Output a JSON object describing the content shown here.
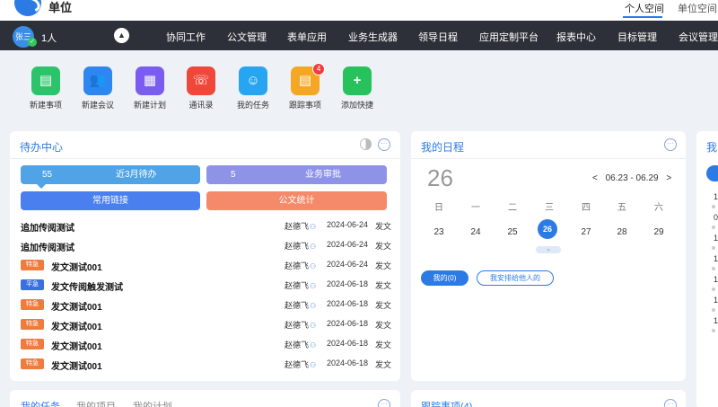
{
  "topbar": {
    "org_name": "单位",
    "spaces": [
      "个人空间",
      "单位空间"
    ]
  },
  "navbar": {
    "avatar_text": "张三",
    "user_count": "1人",
    "items": [
      "协同工作",
      "公文管理",
      "表单应用",
      "业务生成器",
      "领导日程",
      "应用定制平台",
      "报表中心",
      "目标管理",
      "会议管理"
    ]
  },
  "quick_actions": [
    {
      "label": "新建事项",
      "icon": "new-item-icon",
      "glyph": "▤",
      "color": "#2cc46b"
    },
    {
      "label": "新建会议",
      "icon": "meeting-icon",
      "glyph": "👥",
      "color": "#2e86f0"
    },
    {
      "label": "新建计划",
      "icon": "plan-icon",
      "glyph": "▦",
      "color": "#7a5cf0"
    },
    {
      "label": "通讯录",
      "icon": "contacts-icon",
      "glyph": "☏",
      "color": "#f0473b"
    },
    {
      "label": "我的任务",
      "icon": "task-icon",
      "glyph": "☺",
      "color": "#27a5f0"
    },
    {
      "label": "跟踪事项",
      "icon": "track-icon",
      "glyph": "▤",
      "color": "#f5a623",
      "badge": "4"
    },
    {
      "label": "添加快捷",
      "icon": "add-icon",
      "glyph": "+",
      "color": "#28c25d"
    }
  ],
  "todo": {
    "title": "待办中心",
    "buttons": [
      {
        "count": "55",
        "label": "近3月待办",
        "color": "#4fa3e6"
      },
      {
        "count": "5",
        "label": "业务审批",
        "color": "#8e93e8"
      },
      {
        "label": "常用链接",
        "color": "#4a7ff0"
      },
      {
        "label": "公文统计",
        "color": "#f48a6a"
      }
    ],
    "rows": [
      {
        "tag": "",
        "title": "追加传阅测试",
        "person": "赵德飞",
        "date": "2024-06-24",
        "type": "发文"
      },
      {
        "tag": "",
        "title": "追加传阅测试",
        "person": "赵德飞",
        "date": "2024-06-24",
        "type": "发文"
      },
      {
        "tag": "特急",
        "tag_color": "#f07b3f",
        "title": "发文测试001",
        "person": "赵德飞",
        "date": "2024-06-24",
        "type": "发文"
      },
      {
        "tag": "平急",
        "tag_color": "#3a6fe0",
        "title": "发文传阅触发测试",
        "person": "赵德飞",
        "date": "2024-06-18",
        "type": "发文"
      },
      {
        "tag": "特急",
        "tag_color": "#f07b3f",
        "title": "发文测试001",
        "person": "赵德飞",
        "date": "2024-06-18",
        "type": "发文"
      },
      {
        "tag": "特急",
        "tag_color": "#f07b3f",
        "title": "发文测试001",
        "person": "赵德飞",
        "date": "2024-06-18",
        "type": "发文"
      },
      {
        "tag": "特急",
        "tag_color": "#f07b3f",
        "title": "发文测试001",
        "person": "赵德飞",
        "date": "2024-06-18",
        "type": "发文"
      },
      {
        "tag": "特急",
        "tag_color": "#f07b3f",
        "title": "发文测试001",
        "person": "赵德飞",
        "date": "2024-06-18",
        "type": "发文"
      }
    ]
  },
  "schedule": {
    "title": "我的日程",
    "big_day": "26",
    "prev": "<",
    "range": "06.23 - 06.29",
    "next": ">",
    "weekdays": [
      "日",
      "一",
      "二",
      "三",
      "四",
      "五",
      "六"
    ],
    "days": [
      "23",
      "24",
      "25",
      "26",
      "27",
      "28",
      "29"
    ],
    "today_index": 3,
    "pills": [
      "我的(0)",
      "我安排给他人的"
    ]
  },
  "third_card": {
    "title": "我",
    "numbers": [
      "1",
      "0",
      "1",
      "1",
      "1",
      "1",
      "1"
    ]
  },
  "bottom": {
    "left_tabs": [
      "我的任务",
      "我的项目",
      "我的计划"
    ],
    "middle_title": "跟踪事项(4)"
  }
}
